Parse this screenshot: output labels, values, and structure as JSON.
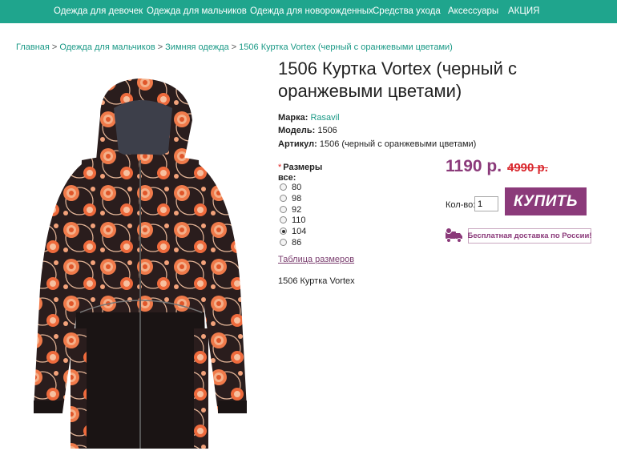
{
  "nav": {
    "items": [
      {
        "label": "Одежда для девочек"
      },
      {
        "label": "Одежда для мальчиков"
      },
      {
        "label": "Одежда для новорожденных"
      },
      {
        "label": "Средства ухода"
      },
      {
        "label": "Аксессуары"
      },
      {
        "label": "АКЦИЯ"
      }
    ]
  },
  "breadcrumb": {
    "items": [
      {
        "label": "Главная"
      },
      {
        "label": "Одежда для мальчиков"
      },
      {
        "label": "Зимняя одежда"
      },
      {
        "label": "1506 Куртка Vortex (черный с оранжевыми цветами)"
      }
    ],
    "separator": ">"
  },
  "product": {
    "title": "1506 Куртка Vortex (черный с оранжевыми цветами)",
    "brand_label": "Марка:",
    "brand_value": "Rasavil",
    "model_label": "Модель:",
    "model_value": "1506",
    "sku_label": "Артикул:",
    "sku_value": "1506 (черный с оранжевыми цветами)",
    "sizes_title": "Размеры все:",
    "required_mark": "*",
    "sizes": [
      {
        "label": "80",
        "selected": false
      },
      {
        "label": "98",
        "selected": false
      },
      {
        "label": "92",
        "selected": false
      },
      {
        "label": "110",
        "selected": false
      },
      {
        "label": "104",
        "selected": true
      },
      {
        "label": "86",
        "selected": false
      }
    ],
    "size_table_link": "Таблица размеров",
    "short_description": "1506 Куртка Vortex",
    "price": "1190 р.",
    "old_price": "4990 р.",
    "qty_label": "Кол-во:",
    "qty_value": "1",
    "buy_label": "КУПИТЬ",
    "delivery_text": "Бесплатная доставка по России!"
  },
  "colors": {
    "nav_bg": "#1fa58d",
    "accent": "#8b3a7a",
    "old_price": "#d9262c",
    "link": "#1a9986"
  },
  "icons": {
    "delivery": "delivery-truck-icon"
  }
}
